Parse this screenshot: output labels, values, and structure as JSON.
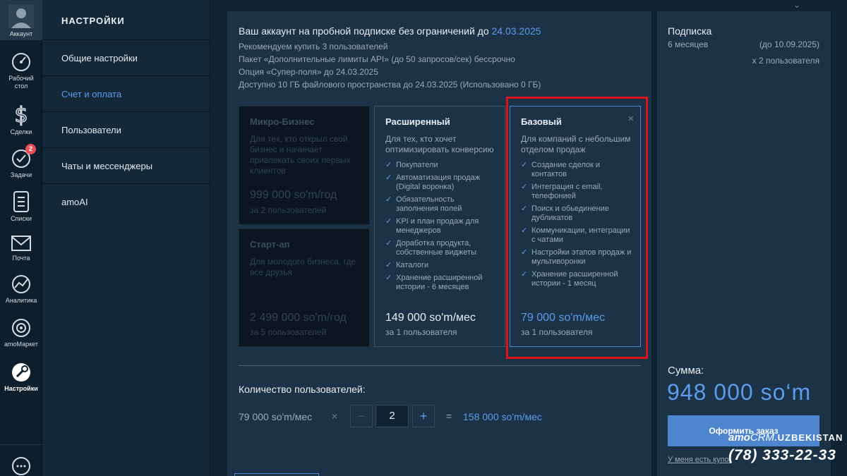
{
  "rail": {
    "account": "Аккаунт",
    "dashboard": "Рабочий\nстол",
    "deals": "Сделки",
    "tasks": "Задачи",
    "tasks_badge": "2",
    "lists": "Списки",
    "mail": "Почта",
    "analytics": "Аналитика",
    "market": "amoМаркет",
    "settings": "Настройки"
  },
  "menu": {
    "title": "НАСТРОЙКИ",
    "items": [
      "Общие настройки",
      "Счет и оплата",
      "Пользователи",
      "Чаты и мессенджеры",
      "amoAI"
    ],
    "active_index": 1
  },
  "header": {
    "title": "Ваш аккаунт на пробной подписке без ограничений до",
    "title_date": "24.03.2025",
    "lines": [
      "Рекомендуем купить 3 пользователей",
      "Пакет «Дополнительные лимиты API» (до 50 запросов/сек) бессрочно",
      "Опция «Супер-поля» до 24.03.2025",
      "Доступно 10 ГБ файлового пространства до 24.03.2025 (Использовано 0 ГБ)"
    ]
  },
  "plans": {
    "micro": {
      "title": "Микро-Бизнес",
      "desc": "Для тех, кто открыл свой бизнес и начинает привлекать своих первых клиентов",
      "price": "999 000 so'm/год",
      "per": "за 2 пользователей"
    },
    "startup": {
      "title": "Старт-ап",
      "desc": "Для молодого бизнеса, где все друзья",
      "price": "2 499 000 so'm/год",
      "per": "за 5 пользователей"
    },
    "extended": {
      "title": "Расширенный",
      "desc": "Для тех, кто хочет оптимизировать конверсию",
      "features": [
        "Покупатели",
        "Автоматизация продаж (Digital воронка)",
        "Обязательность заполнения полей",
        "KPI и план продаж для менеджеров",
        "Доработка продукта, собственные виджеты",
        "Каталоги",
        "Хранение расширенной истории - 6 месяцев"
      ],
      "price": "149 000 so'm/мес",
      "per": "за 1 пользователя"
    },
    "base": {
      "title": "Базовый",
      "desc": "Для компаний с небольшим отделом продаж",
      "features": [
        "Создание сделок и контактов",
        "Интеграция с email, телефонией",
        "Поиск и обьединение дубликатов",
        "Коммуникации, интеграции с чатами",
        "Настройки этапов продаж и мультиворонки",
        "Хранение расширенной истории - 1 месяц"
      ],
      "price": "79 000 so'm/мес",
      "per": "за 1 пользователя",
      "selected": true
    }
  },
  "quantity": {
    "label": "Количество пользователей:",
    "unit_price": "79 000 so'm/мес",
    "times": "×",
    "minus": "−",
    "value": "2",
    "plus": "+",
    "equals": "=",
    "total": "158 000 so'm/мес"
  },
  "summary": {
    "title": "Подписка",
    "period": "6 месяцев",
    "until": "(до 10.09.2025)",
    "users": "x 2 пользователя",
    "sum_label": "Сумма:",
    "sum_value": "948 000 so‘m",
    "order_button": "Оформить заказ",
    "promo_link": "У меня есть купон"
  },
  "watermark": {
    "brand_amo": "amo",
    "brand_crm": "CRM",
    "brand_country": ".UZBEKISTAN",
    "phone": "(78) 333-22-33"
  },
  "colors": {
    "accent": "#5c9bea",
    "button": "#4d86cf",
    "panel": "#1c3347",
    "background": "#0f2333",
    "highlight_frame": "#d9141b",
    "badge": "#e7505a"
  }
}
